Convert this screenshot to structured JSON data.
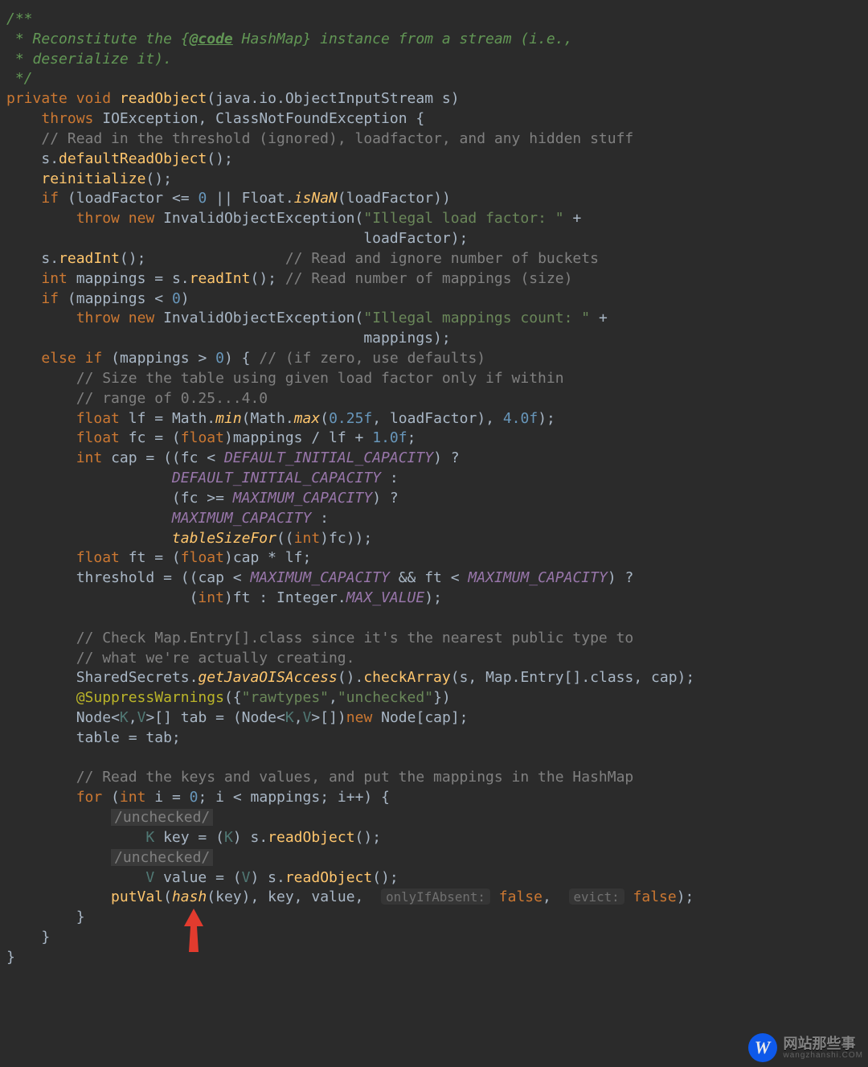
{
  "javadoc": {
    "open": "/**",
    "l1_a": " * Reconstitute the {",
    "l1_link": "@code",
    "l1_b": " HashMap} instance from a stream (i.e.,",
    "l2": " * deserialize it).",
    "close": " */"
  },
  "kw": {
    "private": "private",
    "void": "void",
    "throws": "throws",
    "if": "if",
    "else": "else",
    "throw": "throw",
    "new": "new",
    "int": "int",
    "float": "float",
    "for": "for",
    "false": "false"
  },
  "fn": {
    "readObject": "readObject",
    "defaultReadObject": "defaultReadObject",
    "reinitialize": "reinitialize",
    "isNaN": "isNaN",
    "readInt": "readInt",
    "min": "min",
    "max": "max",
    "tableSizeFor": "tableSizeFor",
    "getJavaOISAccess": "getJavaOISAccess",
    "checkArray": "checkArray",
    "putVal": "putVal",
    "hash": "hash"
  },
  "id": {
    "ObjectInputStream": "java.io.ObjectInputStream",
    "IOException": "IOException",
    "ClassNotFoundException": "ClassNotFoundException",
    "InvalidObjectException": "InvalidObjectException",
    "Float": "Float",
    "Math": "Math",
    "Integer": "Integer",
    "SharedSecrets": "SharedSecrets",
    "Map_Entry": "Map.Entry[]",
    "Node": "Node",
    "class": "class",
    "s": "s",
    "mappings": "mappings",
    "loadFactor": "loadFactor",
    "lf": "lf",
    "fc": "fc",
    "cap": "cap",
    "ft": "ft",
    "threshold": "threshold",
    "tab": "tab",
    "table": "table",
    "i": "i",
    "key": "key",
    "value": "value"
  },
  "type": {
    "K": "K",
    "V": "V"
  },
  "const": {
    "DEFAULT_INITIAL_CAPACITY": "DEFAULT_INITIAL_CAPACITY",
    "MAXIMUM_CAPACITY": "MAXIMUM_CAPACITY",
    "MAX_VALUE": "MAX_VALUE"
  },
  "str": {
    "illegal_lf": "\"Illegal load factor: \"",
    "illegal_mc": "\"Illegal mappings count: \"",
    "rawtypes": "\"rawtypes\"",
    "unchecked": "\"unchecked\""
  },
  "num": {
    "zero": "0",
    "n0_25f": "0.25f",
    "n4_0f": "4.0f",
    "n1_0f": "1.0f"
  },
  "cmt": {
    "threshold": "// Read in the threshold (ignored), loadfactor, and any hidden stuff",
    "ignore_buckets": "// Read and ignore number of buckets",
    "read_mappings": "// Read number of mappings (size)",
    "zero_defaults": "// (if zero, use defaults)",
    "size1": "// Size the table using given load factor only if within",
    "size2": "// range of 0.25...4.0",
    "check1": "// Check Map.Entry[].class since it's the nearest public type to",
    "check2": "// what we're actually creating.",
    "readkv": "// Read the keys and values, and put the mappings in the HashMap"
  },
  "ann": {
    "SuppressWarnings": "@SuppressWarnings",
    "unchecked_block": "/unchecked/"
  },
  "hint": {
    "onlyIfAbsent": "onlyIfAbsent:",
    "evict": "evict:"
  },
  "watermark": {
    "badge": "W",
    "title": "网站那些事",
    "sub": "wangzhanshi.COM"
  }
}
